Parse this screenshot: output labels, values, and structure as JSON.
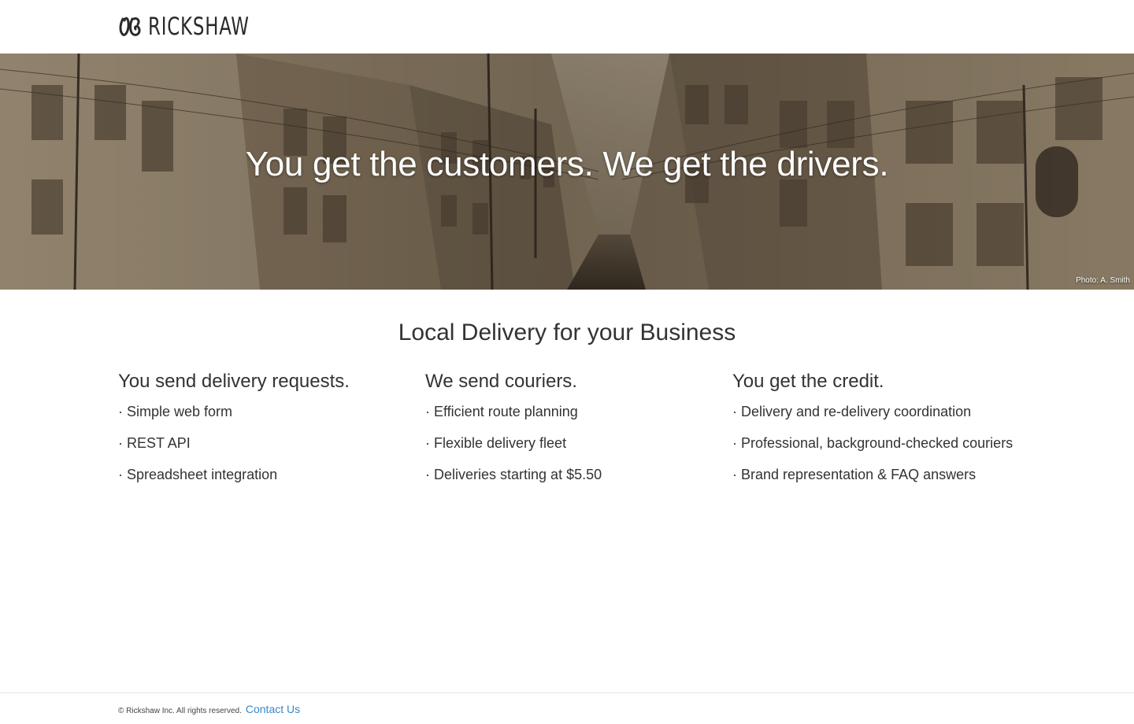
{
  "brand": {
    "name": "Rickshaw",
    "logo_icon": "rickshaw-logo-icon"
  },
  "hero": {
    "title": "You get the customers. We get the drivers.",
    "photo_credit": "Photo: A. Smith",
    "tint": "#7d6b55"
  },
  "intro": {
    "title": "Local Delivery for your Business"
  },
  "columns": [
    {
      "heading": "You send delivery requests.",
      "items": [
        "Simple web form",
        "REST API",
        "Spreadsheet integration"
      ]
    },
    {
      "heading": "We send couriers.",
      "items": [
        "Efficient route planning",
        "Flexible delivery fleet",
        "Deliveries starting at $5.50"
      ]
    },
    {
      "heading": "You get the credit.",
      "items": [
        "Delivery and re-delivery coordination",
        "Professional, background-checked couriers",
        "Brand representation & FAQ answers"
      ]
    }
  ],
  "footer": {
    "copyright": "© Rickshaw Inc. All rights reserved.",
    "contact_label": "Contact Us"
  },
  "colors": {
    "link": "#3a86c8",
    "text": "#333333"
  }
}
